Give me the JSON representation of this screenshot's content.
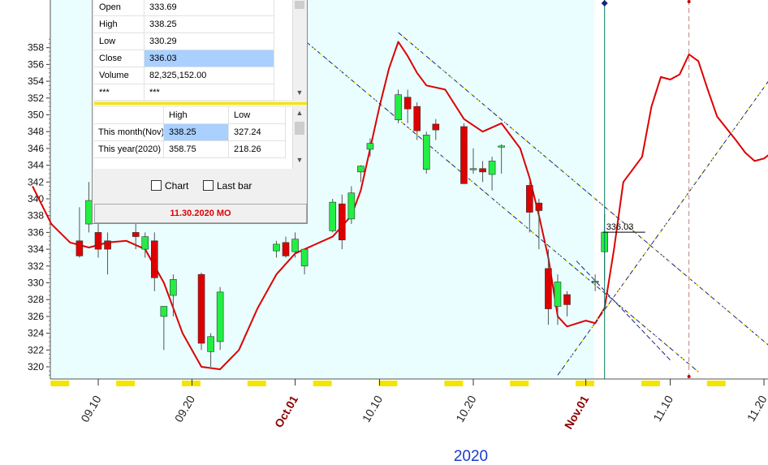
{
  "chart_data": {
    "type": "candlestick",
    "year_label": "2020",
    "y_ticks": [
      "320",
      "322",
      "324",
      "326",
      "328",
      "330",
      "332",
      "334",
      "336",
      "338",
      "340",
      "342",
      "344",
      "346",
      "348",
      "350",
      "352",
      "354",
      "356",
      "358"
    ],
    "ylim": [
      319,
      359
    ],
    "x_tick_labels": [
      {
        "label": "09.10",
        "month": false
      },
      {
        "label": "09.20",
        "month": false
      },
      {
        "label": "Oct.01",
        "month": true
      },
      {
        "label": "10.10",
        "month": false
      },
      {
        "label": "10.20",
        "month": false
      },
      {
        "label": "Nov.01",
        "month": true
      },
      {
        "label": "11.10",
        "month": false
      },
      {
        "label": "11.20",
        "month": false
      }
    ],
    "candles": [
      {
        "date": "09.08",
        "open": 335,
        "high": 339,
        "low": 333,
        "close": 333.2
      },
      {
        "date": "09.09",
        "open": 337,
        "high": 342,
        "low": 336,
        "close": 339.8
      },
      {
        "date": "09.10",
        "open": 336,
        "high": 337,
        "low": 333,
        "close": 334
      },
      {
        "date": "09.11",
        "open": 335,
        "high": 336,
        "low": 331,
        "close": 334
      },
      {
        "date": "09.14",
        "open": 336,
        "high": 337,
        "low": 334,
        "close": 335.5
      },
      {
        "date": "09.15",
        "open": 334,
        "high": 336,
        "low": 333,
        "close": 335.5
      },
      {
        "date": "09.16",
        "open": 335,
        "high": 336,
        "low": 329,
        "close": 330.6
      },
      {
        "date": "09.17",
        "open": 326,
        "high": 327,
        "low": 322,
        "close": 327.2
      },
      {
        "date": "09.18",
        "open": 328.5,
        "high": 331,
        "low": 326,
        "close": 330.4
      },
      {
        "date": "09.21",
        "open": 331,
        "high": 331.2,
        "low": 322,
        "close": 322.8
      },
      {
        "date": "09.22",
        "open": 321.8,
        "high": 324,
        "low": 320,
        "close": 323.6
      },
      {
        "date": "09.23",
        "open": 323,
        "high": 329.5,
        "low": 322,
        "close": 328.9
      },
      {
        "date": "09.29",
        "open": 333.8,
        "high": 335,
        "low": 333,
        "close": 334.6
      },
      {
        "date": "09.30",
        "open": 334.8,
        "high": 335.5,
        "low": 333,
        "close": 333.2
      },
      {
        "date": "10.01",
        "open": 333.7,
        "high": 336,
        "low": 333,
        "close": 335.2
      },
      {
        "date": "10.02",
        "open": 332,
        "high": 333.5,
        "low": 331,
        "close": 334
      },
      {
        "date": "10.05",
        "open": 336.2,
        "high": 340,
        "low": 336,
        "close": 339.6
      },
      {
        "date": "10.06",
        "open": 339.4,
        "high": 340.5,
        "low": 334,
        "close": 335.1
      },
      {
        "date": "10.07",
        "open": 337.6,
        "high": 341.5,
        "low": 337,
        "close": 340.7
      },
      {
        "date": "10.08",
        "open": 343.2,
        "high": 344,
        "low": 342,
        "close": 343.9
      },
      {
        "date": "10.09",
        "open": 345.9,
        "high": 347.2,
        "low": 345,
        "close": 346.6
      },
      {
        "date": "10.12",
        "open": 349.4,
        "high": 353,
        "low": 349,
        "close": 352.4
      },
      {
        "date": "10.13",
        "open": 352.1,
        "high": 353,
        "low": 349,
        "close": 350.7
      },
      {
        "date": "10.14",
        "open": 351,
        "high": 351.5,
        "low": 347,
        "close": 348.1
      },
      {
        "date": "10.15",
        "open": 343.5,
        "high": 348,
        "low": 343,
        "close": 347.6
      },
      {
        "date": "10.16",
        "open": 348.9,
        "high": 349.5,
        "low": 347,
        "close": 348.2
      },
      {
        "date": "10.19",
        "open": 348.6,
        "high": 349,
        "low": 342,
        "close": 341.8
      },
      {
        "date": "10.20",
        "open": 343.6,
        "high": 346,
        "low": 343,
        "close": 343.6
      },
      {
        "date": "10.21",
        "open": 343.6,
        "high": 344.5,
        "low": 342,
        "close": 343.2
      },
      {
        "date": "10.22",
        "open": 342.9,
        "high": 345,
        "low": 341,
        "close": 344.5
      },
      {
        "date": "10.23",
        "open": 346.3,
        "high": 346.5,
        "low": 343,
        "close": 346.3
      },
      {
        "date": "10.26",
        "open": 341.6,
        "high": 342,
        "low": 336,
        "close": 338.4
      },
      {
        "date": "10.27",
        "open": 339.5,
        "high": 340,
        "low": 334,
        "close": 338.6
      },
      {
        "date": "10.28",
        "open": 331.7,
        "high": 334,
        "low": 325,
        "close": 326.9
      },
      {
        "date": "10.29",
        "open": 327.2,
        "high": 331,
        "low": 325,
        "close": 330.1
      },
      {
        "date": "10.30",
        "open": 328.6,
        "high": 329,
        "low": 326,
        "close": 327.4
      },
      {
        "date": "11.02",
        "open": 330.2,
        "high": 331,
        "low": 329,
        "close": 330.2
      },
      {
        "date": "11.03",
        "open": 333.7,
        "high": 338.25,
        "low": 330.29,
        "close": 336.03
      }
    ],
    "last_price_label": "336.03"
  },
  "panel": {
    "ohlc": [
      {
        "label": "Open",
        "value": "333.69"
      },
      {
        "label": "High",
        "value": "338.25"
      },
      {
        "label": "Low",
        "value": "330.29"
      },
      {
        "label": "Close",
        "value": "336.03"
      },
      {
        "label": "Volume",
        "value": "82,325,152.00"
      },
      {
        "label": "***",
        "value": "***"
      }
    ],
    "range_headers": {
      "high": "High",
      "low": "Low"
    },
    "ranges": [
      {
        "label": "This month(Nov)",
        "high": "338.25",
        "low": "327.24"
      },
      {
        "label": "This year(2020)",
        "high": "358.75",
        "low": "218.26"
      }
    ],
    "chart_checkbox_label": "Chart",
    "lastbar_checkbox_label": "Last bar",
    "date_label": "11.30.2020 MO"
  },
  "colors": {
    "background": "#eafeff",
    "bull": "#22ee44",
    "bear": "#dd0000",
    "moving_average": "#dd0000",
    "channel_dark": "#1a237e",
    "channel_light": "#f5e400"
  }
}
